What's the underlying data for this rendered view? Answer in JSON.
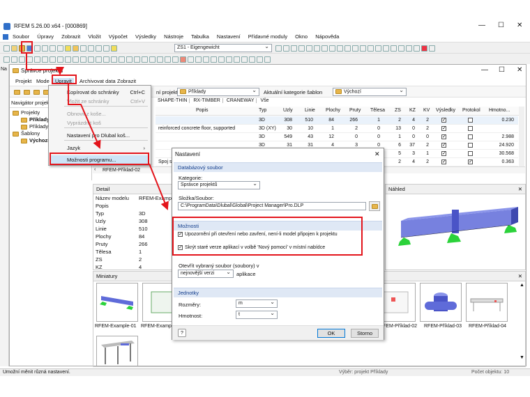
{
  "app": {
    "title": "RFEM 5.26.00 x64 - [000869]",
    "menu": [
      "Soubor",
      "Úpravy",
      "Zobrazit",
      "Vložit",
      "Výpočet",
      "Výsledky",
      "Nástroje",
      "Tabulka",
      "Nastavení",
      "Přídavné moduly",
      "Okno",
      "Nápověda"
    ],
    "loadcase": "ZS1 - Eigengewicht",
    "status_left": "Umožní měnit různá nastavení.",
    "status_mid": "Výběr: projekt Příklady",
    "status_right": "Počet objektu: 10",
    "left_strip_label": "Na"
  },
  "pm": {
    "title": "Správce projektů",
    "menu": [
      "Projekt",
      "Mode",
      "Upravit",
      "Archivovat data",
      "Zobrazit"
    ],
    "current_project_label": "ní projekt:",
    "current_project": "Příklady",
    "template_label": "Aktuální kategorie šablon",
    "template_value": "Výchozí",
    "tabs": [
      "SHAPE-THIN",
      "RX-TIMBER",
      "CRANEWAY",
      "Vše"
    ],
    "navigator_title": "Navigátor projektů",
    "tree": [
      {
        "label": "Projekty",
        "indent": 0,
        "bold": false
      },
      {
        "label": "Příklady",
        "indent": 1,
        "bold": true
      },
      {
        "label": "Příklady",
        "indent": 1,
        "bold": false
      },
      {
        "label": "Šablony",
        "indent": 0,
        "bold": false
      },
      {
        "label": "Výchozí",
        "indent": 1,
        "bold": true
      }
    ],
    "columns": [
      "Popis",
      "Typ",
      "Uzly",
      "Linie",
      "Plochy",
      "Pruty",
      "Tělesa",
      "ZS",
      "KZ",
      "KV",
      "Výsledky",
      "Protokol",
      "Hmotno..."
    ],
    "rows": [
      {
        "desc": "",
        "type": "3D",
        "uzly": "308",
        "linie": "510",
        "plochy": "84",
        "pruty": "266",
        "telesa": "1",
        "zs": "2",
        "kz": "4",
        "kv": "2",
        "vysl": true,
        "prot": false,
        "hm": "0.230"
      },
      {
        "desc": "reinforced concrete floor, supported",
        "type": "3D (XY)",
        "uzly": "30",
        "linie": "10",
        "plochy": "1",
        "pruty": "2",
        "telesa": "0",
        "zs": "13",
        "kz": "0",
        "kv": "2",
        "vysl": true,
        "prot": false,
        "hm": ""
      },
      {
        "desc": "",
        "type": "3D",
        "uzly": "549",
        "linie": "43",
        "plochy": "12",
        "pruty": "0",
        "telesa": "0",
        "zs": "1",
        "kz": "0",
        "kv": "0",
        "vysl": true,
        "prot": false,
        "hm": "2.988"
      },
      {
        "desc": "",
        "type": "3D",
        "uzly": "31",
        "linie": "31",
        "plochy": "4",
        "pruty": "3",
        "telesa": "0",
        "zs": "6",
        "kz": "37",
        "kv": "2",
        "vysl": true,
        "prot": false,
        "hm": "24.920"
      },
      {
        "desc": "",
        "type": "",
        "uzly": "",
        "linie": "",
        "plochy": "",
        "pruty": "",
        "telesa": "",
        "zs": "5",
        "kz": "3",
        "kv": "1",
        "vysl": true,
        "prot": false,
        "hm": "30.568"
      },
      {
        "desc": "Spoj s",
        "type": "",
        "uzly": "",
        "linie": "",
        "plochy": "",
        "pruty": "",
        "telesa": "",
        "zs": "2",
        "kz": "4",
        "kv": "2",
        "vysl": true,
        "prot": true,
        "hm": "0.363"
      }
    ],
    "row_label": "RFEM-Příklad-02",
    "detail_title": "Detail",
    "detail": [
      {
        "k": "Název modelu",
        "v": "RFEM-Example"
      },
      {
        "k": "Popis",
        "v": ""
      },
      {
        "k": "Typ",
        "v": "3D"
      },
      {
        "k": "Uzly",
        "v": "308"
      },
      {
        "k": "Linie",
        "v": "510"
      },
      {
        "k": "Plochy",
        "v": "84"
      },
      {
        "k": "Pruty",
        "v": "266"
      },
      {
        "k": "Tělesa",
        "v": "1"
      },
      {
        "k": "ZS",
        "v": "2"
      },
      {
        "k": "KZ",
        "v": "4"
      }
    ],
    "preview_title": "Náhled",
    "thumbs_title": "Miniatury",
    "thumbs": [
      "RFEM-Example-01",
      "RFEM-Example",
      "RFEM-Příklad-02",
      "RFEM-Příklad-03",
      "RFEM-Příklad-04"
    ]
  },
  "edit_menu": {
    "items": [
      {
        "label": "Kopírovat do schránky",
        "shortcut": "Ctrl+C",
        "disabled": false
      },
      {
        "label": "Vložit ze schránky",
        "shortcut": "Ctrl+V",
        "disabled": true
      },
      {
        "label": "Obnovit z koše...",
        "shortcut": "",
        "disabled": true
      },
      {
        "label": "Vyprázdnit koš",
        "shortcut": "",
        "disabled": true
      },
      {
        "label": "Nastavení pro Dlubal koš...",
        "shortcut": "",
        "disabled": false
      },
      {
        "label": "Jazyk",
        "shortcut": "›",
        "disabled": false
      },
      {
        "label": "Možnosti programu...",
        "shortcut": "",
        "disabled": false
      }
    ]
  },
  "settings": {
    "title": "Nastavení",
    "db_section": "Databázový soubor",
    "category_label": "Kategorie:",
    "category_value": "Správce projektů",
    "folder_label": "Složka/Soubor:",
    "folder_value": "C:\\ProgramData\\Dlubal\\Global\\Project Manager\\Pro.DLP",
    "options_section": "Možnosti",
    "option1": "Upozornění při otevření nebo zavření, není-li model připojen k projektu",
    "option2": "Skrýt staré verze aplikací v volbě 'Nový pomocí' v místní nabídce",
    "open_label": "Otevřít vybraný soubor (soubory) v",
    "open_value": "nejnovější verzi",
    "open_suffix": "aplikace",
    "units_section": "Jednotky",
    "length_label": "Rozměry:",
    "length_value": "m",
    "mass_label": "Hmotnost:",
    "mass_value": "t",
    "ok": "OK",
    "cancel": "Storno",
    "close": "✕"
  },
  "colors": {
    "accent": "#e3141b",
    "selection": "#cde4f7",
    "section": "#dfe8f5",
    "beam": "#5f6bd9",
    "support": "#2bd23a"
  }
}
